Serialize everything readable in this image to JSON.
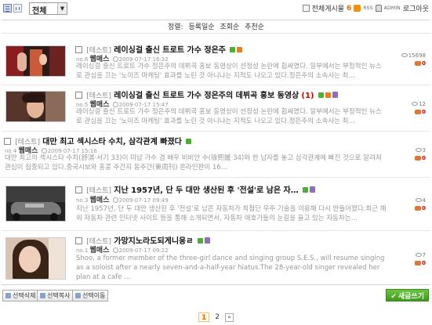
{
  "toolbar": {
    "category": "전체",
    "all_posts_label": "전체게시물",
    "all_posts_count": "6",
    "rss_label": "RSS",
    "admin_label": "ADMIN",
    "logout_label": "로그아웃"
  },
  "sort": {
    "label": "정렬:",
    "options": [
      "등록일순",
      "조회순",
      "추천순"
    ]
  },
  "posts": [
    {
      "no": "no.6",
      "category": "[테스트]",
      "title": "레이싱걸 출신 트로트 가수 정은주",
      "comment_count": "",
      "author": "웹매스",
      "date": "2009-07-17 16:32",
      "summary": "레이싱걸 출신 트로트 가수 정은주의 데뷔곡 홍보 동영상이 선정성 논란에 휩싸였다. 일부에서는 부정적인 뉴스로 관심을 끄는 '노이즈 마케팅' 효과를 노린 것 아니냐는 지적도 나오고 있다.정은주의 소속사는 최…",
      "views": "15698",
      "comments": "0",
      "badges": [
        "new",
        "hot"
      ]
    },
    {
      "no": "no.5",
      "category": "[테스트]",
      "title": "레이싱걸 출신 트로트 가수 정은주의 데뷔곡 홍보 동영상",
      "comment_count": "(1)",
      "author": "웹매스",
      "date": "2009-07-17 15:47",
      "summary": "레이싱걸 출신 트로트 가수 정은주의 데뷔곡 홍보 동영상이 선정성 논란에 휩싸였다. 일부에서는 부정적인 뉴스로 관심을 끄는 '노이즈 마케팅' 효과를 노린 것 아니냐는 지적도 나오고 있다.정은주의 소속사는 최…",
      "views": "12",
      "comments": "0",
      "badges": [
        "new",
        "hot",
        "file"
      ]
    },
    {
      "no": "no.4",
      "category": "[테스트]",
      "title": "대만 최고 섹시스타 수치, 삼각관계 빠졌다",
      "comment_count": "",
      "author": "웹매스",
      "date": "2009-07-17 15:16",
      "summary": "대만 최고의 섹시스타 수치(舒淇·서기 33)이 미남 가수 겸 배우 비비안 수(徐熙媛 34)와 한 남자를 놓고 삼각관계에 빠진 것으로 알려져 관심이 집중되고 있다.중국시보와 홍콩 주간지 동주간(東周刊) 온라인판이 16…",
      "views": "3",
      "comments": "0",
      "badges": [
        "new"
      ]
    },
    {
      "no": "no.3",
      "category": "[테스트]",
      "title": "지난 1957년, 단 두 대만 생산된 후 '전설'로 남은 자…",
      "comment_count": "",
      "author": "웹매스",
      "date": "2009-07-17 09:49",
      "summary": "지난 1957년, 단 두 대만 생산된 후 '전설'로 남은 자동차가 최첨단 우주 기술을 이용해 다시 만들어졌다.최근 해외 자동차 관련 인터넷 사이트 등을 통해 소개되면서, 자동차 애호가들의 눈길을 끌고 있는 자동차는…",
      "views": "4",
      "comments": "0",
      "badges": [
        "new",
        "file"
      ]
    },
    {
      "no": "no.1",
      "category": "[테스트]",
      "title": "가망지노라도되게니웅ㄹ",
      "comment_count": "",
      "author": "웹매스",
      "date": "2009-07-17 09:22",
      "summary": "Shoo, a former member of the three-girl dance and singing group S.E.S., will resume singing as a soloist after a nearly seven-and-a-half-year hiatus.The 28-year-old singer revealed her plan at a cafe …",
      "views": "7",
      "comments": "0",
      "badges": [
        "new",
        "file"
      ]
    }
  ],
  "actions": {
    "delete": "선택삭제",
    "copy": "선택복사",
    "move": "선택이동",
    "write": "새글쓰기"
  },
  "pagination": {
    "pages": [
      "1",
      "2"
    ],
    "current": "1",
    "next": "»"
  },
  "colors": {
    "accent_orange": "#e96b00",
    "write_green": "#4aa823",
    "badge_new": "#4cae33",
    "badge_hot": "#ef7d16"
  }
}
